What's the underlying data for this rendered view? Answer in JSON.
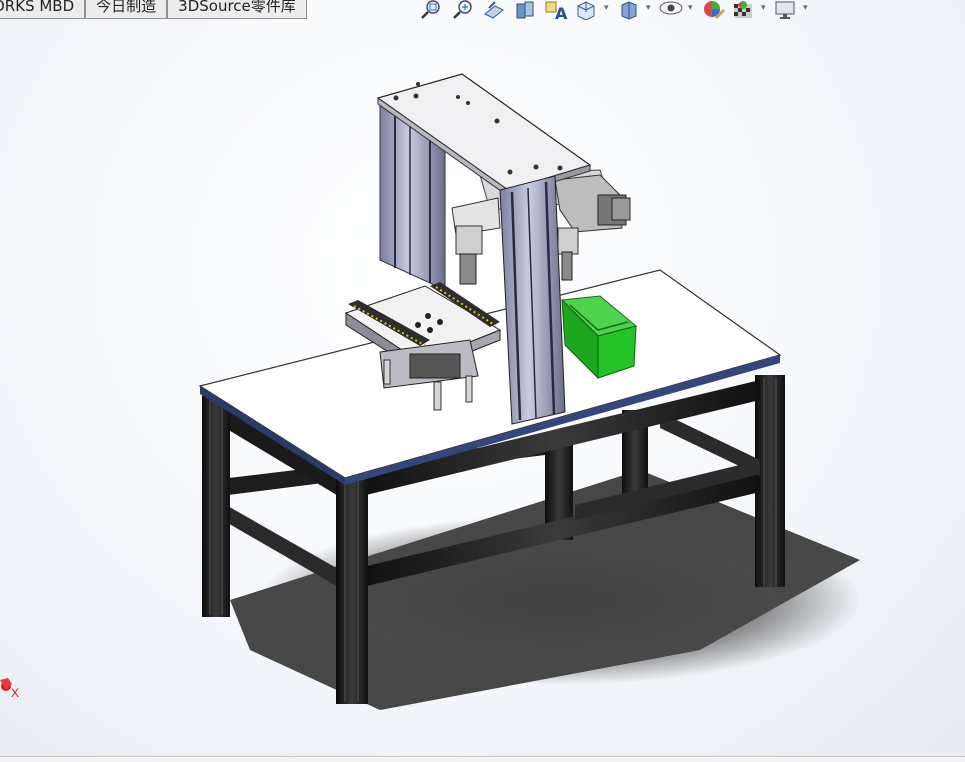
{
  "tabs": [
    {
      "label": "ORKS MBD"
    },
    {
      "label": "今日制造"
    },
    {
      "label": "3DSource零件库"
    }
  ],
  "toolbar": {
    "icons": [
      "zoom-to-fit-icon",
      "zoom-area-icon",
      "previous-view-icon",
      "section-view-icon",
      "annotation-icon",
      "view-orientation-icon",
      "display-style-icon",
      "hide-show-icon",
      "edit-appearance-icon",
      "apply-scene-icon",
      "view-settings-icon"
    ]
  },
  "viewport": {
    "background_top": "#ffffff",
    "background_bottom": "#e6ebf2",
    "frame_color": "#1a1a1a",
    "plate_color": "#ffffff",
    "bin_color": "#22c427",
    "axis_label": "X"
  },
  "model": "workstation-assembly"
}
